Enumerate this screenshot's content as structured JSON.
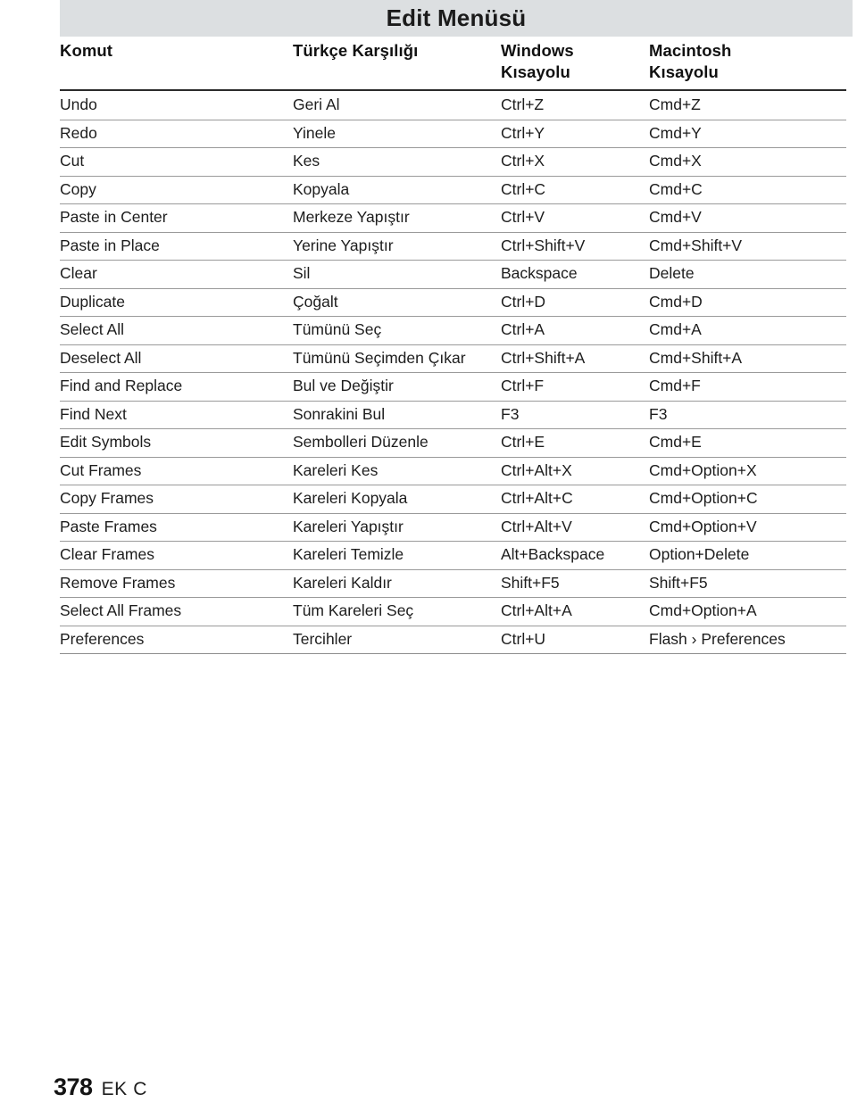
{
  "title": "Edit Menüsü",
  "columns": [
    "Komut",
    "Türkçe Karşılığı",
    "Windows\nKısayolu",
    "Macintosh\nKısayolu"
  ],
  "rows": [
    {
      "command": "Undo",
      "turkish": "Geri Al",
      "windows": "Ctrl+Z",
      "macintosh": "Cmd+Z"
    },
    {
      "command": "Redo",
      "turkish": "Yinele",
      "windows": "Ctrl+Y",
      "macintosh": "Cmd+Y"
    },
    {
      "command": "Cut",
      "turkish": "Kes",
      "windows": "Ctrl+X",
      "macintosh": "Cmd+X"
    },
    {
      "command": "Copy",
      "turkish": "Kopyala",
      "windows": "Ctrl+C",
      "macintosh": "Cmd+C"
    },
    {
      "command": "Paste in Center",
      "turkish": "Merkeze Yapıştır",
      "windows": "Ctrl+V",
      "macintosh": "Cmd+V"
    },
    {
      "command": "Paste in Place",
      "turkish": "Yerine Yapıştır",
      "windows": "Ctrl+Shift+V",
      "macintosh": "Cmd+Shift+V"
    },
    {
      "command": "Clear",
      "turkish": "Sil",
      "windows": "Backspace",
      "macintosh": "Delete"
    },
    {
      "command": "Duplicate",
      "turkish": "Çoğalt",
      "windows": "Ctrl+D",
      "macintosh": "Cmd+D"
    },
    {
      "command": "Select All",
      "turkish": "Tümünü Seç",
      "windows": "Ctrl+A",
      "macintosh": "Cmd+A"
    },
    {
      "command": "Deselect All",
      "turkish": "Tümünü Seçimden Çıkar",
      "windows": "Ctrl+Shift+A",
      "macintosh": "Cmd+Shift+A"
    },
    {
      "command": "Find and Replace",
      "turkish": "Bul ve Değiştir",
      "windows": "Ctrl+F",
      "macintosh": "Cmd+F"
    },
    {
      "command": "Find Next",
      "turkish": "Sonrakini Bul",
      "windows": "F3",
      "macintosh": "F3"
    },
    {
      "command": "Edit Symbols",
      "turkish": "Sembolleri Düzenle",
      "windows": "Ctrl+E",
      "macintosh": "Cmd+E"
    },
    {
      "command": "Cut Frames",
      "turkish": "Kareleri Kes",
      "windows": "Ctrl+Alt+X",
      "macintosh": "Cmd+Option+X"
    },
    {
      "command": "Copy Frames",
      "turkish": "Kareleri Kopyala",
      "windows": "Ctrl+Alt+C",
      "macintosh": "Cmd+Option+C"
    },
    {
      "command": "Paste Frames",
      "turkish": "Kareleri Yapıştır",
      "windows": "Ctrl+Alt+V",
      "macintosh": "Cmd+Option+V"
    },
    {
      "command": "Clear Frames",
      "turkish": "Kareleri Temizle",
      "windows": "Alt+Backspace",
      "macintosh": "Option+Delete"
    },
    {
      "command": "Remove Frames",
      "turkish": "Kareleri Kaldır",
      "windows": "Shift+F5",
      "macintosh": "Shift+F5"
    },
    {
      "command": "Select All Frames",
      "turkish": "Tüm Kareleri Seç",
      "windows": "Ctrl+Alt+A",
      "macintosh": "Cmd+Option+A"
    },
    {
      "command": "Preferences",
      "turkish": "Tercihler",
      "windows": "Ctrl+U",
      "macintosh": "Flash › Preferences"
    }
  ],
  "footer": {
    "page_number": "378",
    "section_label": "EK C"
  },
  "colors": {
    "banner_background": "#dcdfe1",
    "text": "#1d1d1d",
    "rule": "#9a9a9a",
    "header_rule": "#2b2b2b"
  }
}
